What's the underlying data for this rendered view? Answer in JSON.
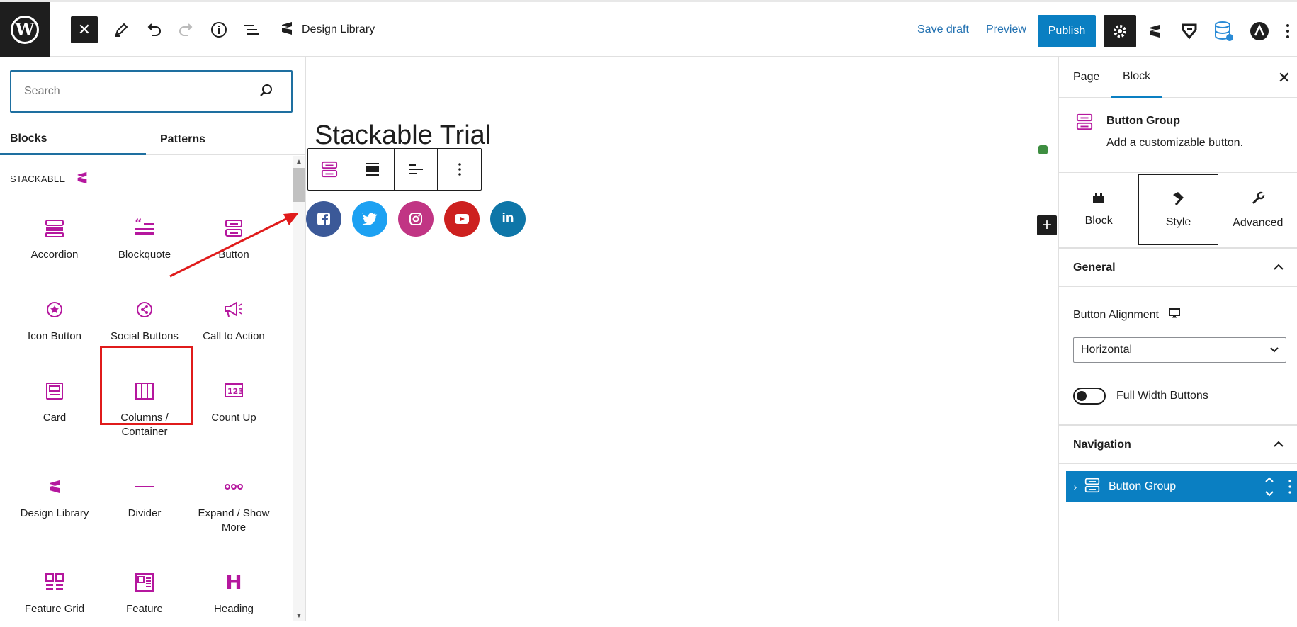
{
  "topbar": {
    "doc_title": "Design Library",
    "save_draft": "Save draft",
    "preview": "Preview",
    "publish": "Publish"
  },
  "inserter": {
    "search_placeholder": "Search",
    "tabs": [
      "Blocks",
      "Patterns"
    ],
    "category": "STACKABLE",
    "blocks": [
      {
        "label": "Accordion",
        "icon": "accordion-icon"
      },
      {
        "label": "Blockquote",
        "icon": "blockquote-icon"
      },
      {
        "label": "Button",
        "icon": "button-icon"
      },
      {
        "label": "Icon Button",
        "icon": "icon-button-icon"
      },
      {
        "label": "Social Buttons",
        "icon": "share-icon"
      },
      {
        "label": "Call to Action",
        "icon": "megaphone-icon"
      },
      {
        "label": "Card",
        "icon": "card-icon"
      },
      {
        "label": "Columns / Container",
        "icon": "columns-icon"
      },
      {
        "label": "Count Up",
        "icon": "count-up-icon"
      },
      {
        "label": "Design Library",
        "icon": "stackable-logo-icon"
      },
      {
        "label": "Divider",
        "icon": "divider-icon"
      },
      {
        "label": "Expand / Show More",
        "icon": "expand-icon"
      },
      {
        "label": "Feature Grid",
        "icon": "feature-grid-icon"
      },
      {
        "label": "Feature",
        "icon": "feature-icon"
      },
      {
        "label": "Heading",
        "icon": "heading-icon"
      }
    ]
  },
  "canvas": {
    "page_title": "Stackable Trial",
    "social_icons": [
      {
        "name": "facebook",
        "color": "#3b5998"
      },
      {
        "name": "twitter",
        "color": "#1da1f2"
      },
      {
        "name": "instagram",
        "color": "#c13584"
      },
      {
        "name": "youtube",
        "color": "#cd201f"
      },
      {
        "name": "linkedin",
        "color": "#0e76a8"
      }
    ],
    "social_glyphs": {
      "twitter": "🐦",
      "linkedin": "in"
    }
  },
  "sidebar": {
    "tabs": [
      "Page",
      "Block"
    ],
    "block_card": {
      "title": "Button Group",
      "description": "Add a customizable button."
    },
    "sub_tabs": [
      "Block",
      "Style",
      "Advanced"
    ],
    "general_title": "General",
    "alignment_label": "Button Alignment",
    "alignment_value": "Horizontal",
    "full_width_label": "Full Width Buttons",
    "navigation_title": "Navigation",
    "nav_item": "Button Group"
  },
  "colors": {
    "accent": "#0a7fc2",
    "stackable": "#b5179e",
    "highlight": "#e01b1b"
  }
}
